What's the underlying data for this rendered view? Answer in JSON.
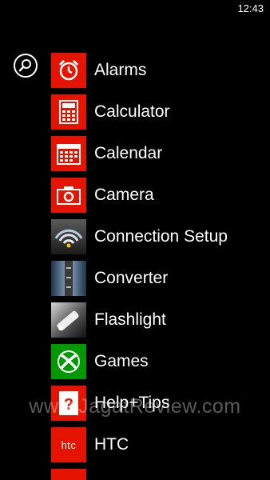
{
  "status_bar": {
    "time": "12:43"
  },
  "search": {
    "icon": "search-icon"
  },
  "apps": [
    {
      "label": "Alarms",
      "icon": "alarm-clock-icon",
      "color": "#e51400"
    },
    {
      "label": "Calculator",
      "icon": "calculator-icon",
      "color": "#e51400"
    },
    {
      "label": "Calendar",
      "icon": "calendar-icon",
      "color": "#e51400"
    },
    {
      "label": "Camera",
      "icon": "camera-icon",
      "color": "#e51400"
    },
    {
      "label": "Connection Setup",
      "icon": "wifi-signal-icon"
    },
    {
      "label": "Converter",
      "icon": "converter-icon"
    },
    {
      "label": "Flashlight",
      "icon": "flashlight-icon"
    },
    {
      "label": "Games",
      "icon": "xbox-icon",
      "color": "#009a00"
    },
    {
      "label": "Help+Tips",
      "icon": "help-icon",
      "color": "#e51400"
    },
    {
      "label": "HTC",
      "icon": "htc-logo-icon",
      "color": "#e51400",
      "tile_text": "htc"
    }
  ],
  "watermark": "www.JagatReview.com"
}
